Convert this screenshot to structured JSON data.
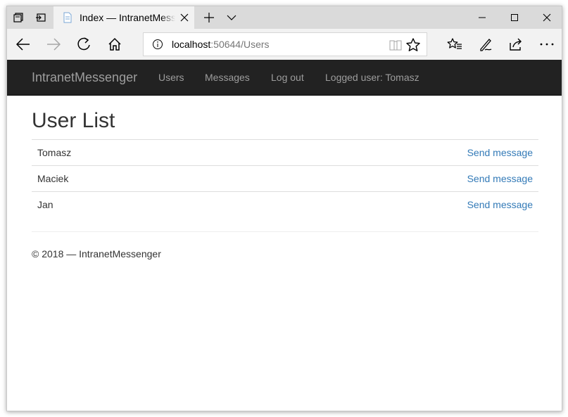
{
  "browser": {
    "tab_title": "Index — IntranetMessenger",
    "address": {
      "host": "localhost",
      "path": ":50644/Users"
    },
    "icons": [
      "tabs-aside-icon",
      "set-tabs-aside-icon",
      "page-icon",
      "close-icon",
      "plus-icon",
      "chevron-down-icon",
      "minimize-icon",
      "maximize-icon",
      "close-window-icon",
      "back-arrow-icon",
      "forward-arrow-icon",
      "refresh-icon",
      "home-icon",
      "info-icon",
      "reading-view-icon",
      "star-icon",
      "favorites-icon",
      "pen-icon",
      "share-icon",
      "more-icon"
    ]
  },
  "site": {
    "brand": "IntranetMessenger",
    "nav": {
      "users": "Users",
      "messages": "Messages",
      "logout": "Log out",
      "logged_user": "Logged user: Tomasz"
    },
    "colors": {
      "navbar_bg": "#222222",
      "nav_text": "#9d9d9d",
      "link": "#337ab7"
    }
  },
  "page": {
    "title": "User List",
    "users": [
      {
        "name": "Tomasz",
        "action": "Send message"
      },
      {
        "name": "Maciek",
        "action": "Send message"
      },
      {
        "name": "Jan",
        "action": "Send message"
      }
    ],
    "footer": "© 2018 — IntranetMessenger"
  }
}
